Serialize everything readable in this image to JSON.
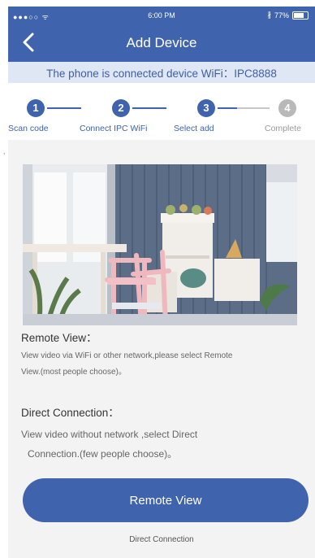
{
  "status_bar": {
    "carrier": "●●●○○ ᯤ",
    "time": "6:00 PM",
    "battery": "77%",
    "battery_level": 0.77
  },
  "nav": {
    "title": "Add Device",
    "back_icon": "chevron-left-icon"
  },
  "banner": {
    "text": "The phone is connected device WiFi：IPC8888"
  },
  "steps": [
    {
      "number": "1",
      "label": "Scan code",
      "state": "done"
    },
    {
      "number": "2",
      "label": "Connect IPC WiFi",
      "state": "done"
    },
    {
      "number": "3",
      "label": "Select add",
      "state": "current"
    },
    {
      "number": "4",
      "label": "Complete",
      "state": "pending"
    }
  ],
  "remote": {
    "title": "Remote View：",
    "description_lines": [
      "View video via WiFi or other network,please select Remote",
      "View.(most people choose)。"
    ]
  },
  "direct": {
    "title": "Direct Connection：",
    "description_lines": [
      "View video without network ,select Direct",
      "Connection.(few people choose)。"
    ]
  },
  "buttons": {
    "primary_label": "Remote View",
    "secondary_label": "Direct Connection"
  },
  "colors": {
    "accent": "#3f63ad",
    "banner_bg": "#dfe7f4",
    "inactive": "#b9b9b9"
  }
}
